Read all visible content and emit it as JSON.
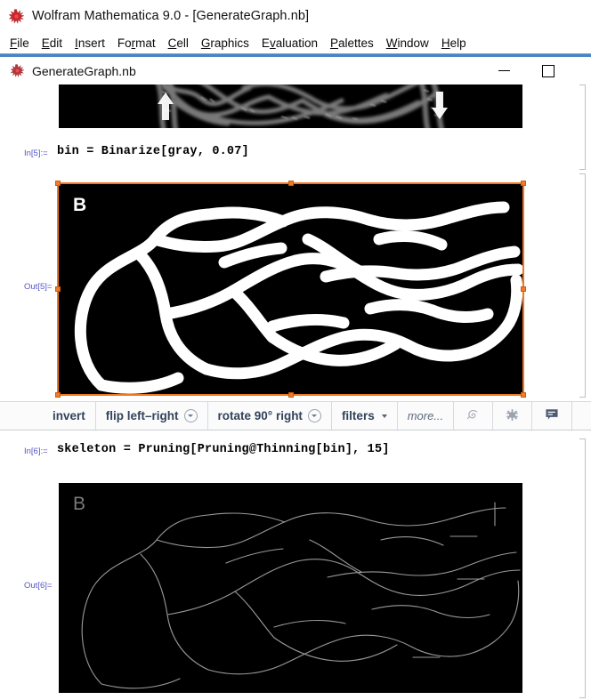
{
  "window": {
    "app_title": "Wolfram Mathematica 9.0 - [GenerateGraph.nb]",
    "logo_icon": "mathematica-spikey-icon",
    "minimize_label": "minimize",
    "maximize_label": "maximize"
  },
  "menubar": {
    "items": [
      {
        "label": "File",
        "accel": "F"
      },
      {
        "label": "Edit",
        "accel": "E"
      },
      {
        "label": "Insert",
        "accel": "I"
      },
      {
        "label": "Format",
        "accel": "r"
      },
      {
        "label": "Cell",
        "accel": "C"
      },
      {
        "label": "Graphics",
        "accel": "G"
      },
      {
        "label": "Evaluation",
        "accel": "v"
      },
      {
        "label": "Palettes",
        "accel": "P"
      },
      {
        "label": "Window",
        "accel": "W"
      },
      {
        "label": "Help",
        "accel": "H"
      }
    ]
  },
  "document": {
    "icon": "notebook-spikey-icon",
    "title": "GenerateGraph.nb"
  },
  "notebook": {
    "cells": [
      {
        "kind": "output-image-clipped",
        "image_name": "gray-tubes-image",
        "image_letter": ""
      },
      {
        "kind": "input",
        "label": "In[5]:=",
        "code": "bin = Binarize[gray, 0.07]"
      },
      {
        "kind": "output-image-selected",
        "label": "Out[5]=",
        "image_name": "binarized-image",
        "image_letter": "B",
        "selected": true
      },
      {
        "kind": "input",
        "label": "In[6]:=",
        "code": "skeleton = Pruning[Pruning@Thinning[bin], 15]"
      },
      {
        "kind": "output-image",
        "label": "Out[6]=",
        "image_name": "skeleton-image",
        "image_letter": "B"
      }
    ]
  },
  "image_toolbar": {
    "buttons": [
      {
        "label": "invert",
        "has_dropdown": false,
        "kind": "text"
      },
      {
        "label": "flip left–right",
        "has_dropdown": true,
        "kind": "text"
      },
      {
        "label": "rotate 90° right",
        "has_dropdown": true,
        "kind": "text"
      },
      {
        "label": "filters",
        "has_dropdown": true,
        "kind": "text-caret"
      },
      {
        "label": "more...",
        "has_dropdown": false,
        "kind": "more"
      }
    ],
    "icon_buttons": [
      {
        "icon": "spikey-evaluate-icon",
        "enabled": false
      },
      {
        "icon": "gear-settings-icon",
        "enabled": true
      },
      {
        "icon": "comment-balloon-icon",
        "enabled": true
      }
    ]
  },
  "colors": {
    "accent_rule": "#4a84c4",
    "selection_orange": "#ee7722",
    "label_blue": "#5555c8",
    "toolbar_text": "#32435a",
    "logo_red": "#c9262b"
  }
}
